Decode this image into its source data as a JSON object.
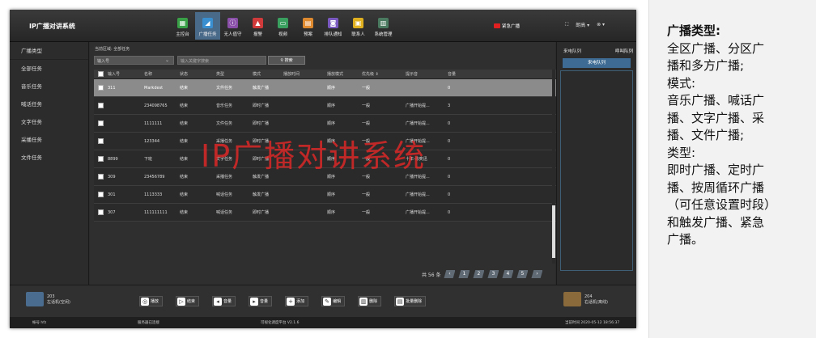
{
  "app": {
    "title": "IP广播对讲系统"
  },
  "nav": [
    {
      "label": "主控台",
      "color": "#3aa048",
      "icon": "grid-icon",
      "glyph": "▦"
    },
    {
      "label": "广播任务",
      "color": "#3a8fd0",
      "icon": "broadcast-icon",
      "glyph": "◢",
      "active": true
    },
    {
      "label": "无人值守",
      "color": "#8a4fa8",
      "icon": "unattended-icon",
      "glyph": "ⓘ"
    },
    {
      "label": "报警",
      "color": "#d03a3a",
      "icon": "alarm-icon",
      "glyph": "▲"
    },
    {
      "label": "视频",
      "color": "#3aa060",
      "icon": "video-icon",
      "glyph": "▭"
    },
    {
      "label": "预案",
      "color": "#e08a30",
      "icon": "plan-icon",
      "glyph": "▤"
    },
    {
      "label": "排队通知",
      "color": "#7a5ac0",
      "icon": "queue-icon",
      "glyph": "◙"
    },
    {
      "label": "联系人",
      "color": "#e0b020",
      "icon": "contacts-icon",
      "glyph": "▣"
    },
    {
      "label": "系统管理",
      "color": "#4a7a60",
      "icon": "settings-icon",
      "glyph": "▥"
    }
  ],
  "emergency": {
    "label": "紧急广播",
    "color": "#e02020"
  },
  "topright": {
    "fullscreen": "⛶",
    "user": "朗高 ▾",
    "avatar": "⊗ ▾"
  },
  "sidebar": [
    "广播类型",
    "全部任务",
    "音乐任务",
    "喊话任务",
    "文字任务",
    "采播任务",
    "文件任务"
  ],
  "crumb": "当前区域: 全部任务",
  "filter": {
    "select": "输入号",
    "keyword_placeholder": "输入关键字搜索",
    "search": "搜索"
  },
  "table": {
    "headers": [
      "",
      "输入号",
      "名称",
      "状态",
      "类型",
      "模式",
      "播放时间",
      "播放模式",
      "优先级 ⇕",
      "提示音",
      "音量"
    ],
    "rows": [
      [
        "",
        "311",
        "Markdest",
        "结束",
        "文件任务",
        "触发广播",
        "",
        "顺序",
        "一般",
        "",
        "0"
      ],
      [
        "",
        "",
        "234098765",
        "结束",
        "音乐任务",
        "即时广播",
        "",
        "顺序",
        "一般",
        "广播开始提...",
        "3"
      ],
      [
        "",
        "",
        "1111111",
        "结束",
        "文件任务",
        "即时广播",
        "",
        "顺序",
        "一般",
        "广播开始提...",
        "0"
      ],
      [
        "",
        "",
        "123344",
        "结束",
        "采播任务",
        "即时广播",
        "",
        "顺序",
        "一般",
        "广播开始提...",
        "0"
      ],
      [
        "",
        "8899",
        "下班",
        "结束",
        "文字任务",
        "即时广播",
        "",
        "顺序",
        "一般",
        "十年-陈奕迅",
        "0"
      ],
      [
        "",
        "309",
        "23456789",
        "结束",
        "采播任务",
        "触发广播",
        "",
        "顺序",
        "一般",
        "广播开始提...",
        "0"
      ],
      [
        "",
        "301",
        "1113333",
        "结束",
        "喊话任务",
        "触发广播",
        "",
        "顺序",
        "一般",
        "广播开始提...",
        "0"
      ],
      [
        "",
        "307",
        "111111111",
        "结束",
        "喊话任务",
        "即时广播",
        "",
        "顺序",
        "一般",
        "广播开始提...",
        "0"
      ]
    ],
    "selected_row": 0
  },
  "watermark": "IP广播对讲系统",
  "pager": {
    "total": "共 56 条",
    "prev": "‹",
    "pages": [
      "1",
      "2",
      "3",
      "4",
      "5"
    ],
    "next": "›"
  },
  "right": {
    "tab1": "来电队列",
    "tab2": "呼叫队列",
    "header": "来电队列"
  },
  "bottom": {
    "left_phone": {
      "num": "203",
      "name": "左话机(空闲)"
    },
    "right_phone": {
      "num": "204",
      "name": "右话机(离线)"
    },
    "actions": [
      {
        "label": "播放",
        "icon": "play-icon",
        "glyph": "◎"
      },
      {
        "label": "结束",
        "icon": "stop-icon",
        "glyph": "▷"
      },
      {
        "label": "音量",
        "icon": "volume-down-icon",
        "glyph": "◂"
      },
      {
        "label": "音量",
        "icon": "volume-up-icon",
        "glyph": "▸"
      },
      {
        "label": "添加",
        "icon": "add-icon",
        "glyph": "+"
      },
      {
        "label": "编辑",
        "icon": "edit-icon",
        "glyph": "✎"
      },
      {
        "label": "删除",
        "icon": "delete-icon",
        "glyph": "▥"
      },
      {
        "label": "批量删除",
        "icon": "batch-delete-icon",
        "glyph": "▤"
      }
    ]
  },
  "status": {
    "left": "帐号 hfz",
    "mid": "服务器已连接",
    "center": "可视化调度平台  V2.1.6",
    "right": "当前时间 2020-05-12 18:56:37"
  },
  "note": {
    "title": "广播类型:",
    "lines": [
      "全区广播、分区广",
      "播和多方广播;",
      "模式:",
      "音乐广播、喊话广",
      "播、文字广播、采",
      "播、文件广播;",
      "类型:",
      "即时广播、定时广",
      "播、按周循环广播",
      "（可任意设置时段）",
      "和触发广播、紧急",
      "广播。"
    ]
  }
}
